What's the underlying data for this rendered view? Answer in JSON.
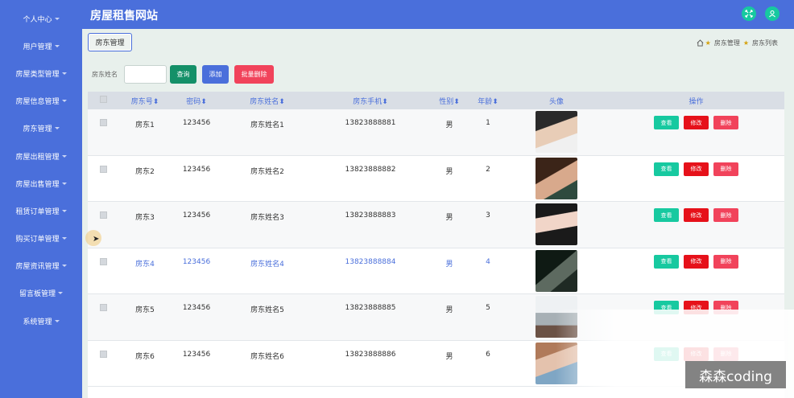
{
  "site_title": "房屋租售网站",
  "sidebar": {
    "items": [
      {
        "label": "个人中心"
      },
      {
        "label": "用户管理"
      },
      {
        "label": "房屋类型管理"
      },
      {
        "label": "房屋信息管理"
      },
      {
        "label": "房东管理"
      },
      {
        "label": "房屋出租管理"
      },
      {
        "label": "房屋出售管理"
      },
      {
        "label": "租赁订单管理"
      },
      {
        "label": "购买订单管理"
      },
      {
        "label": "房屋资讯管理"
      },
      {
        "label": "留言板管理"
      },
      {
        "label": "系统管理"
      }
    ]
  },
  "tab": {
    "label": "房东管理"
  },
  "breadcrumb": {
    "home_icon": "home-icon",
    "item1": "房东管理",
    "item2": "房东列表"
  },
  "search": {
    "label": "房东姓名",
    "value": "",
    "query_label": "查询",
    "add_label": "添加",
    "batch_delete_label": "批量删除"
  },
  "table": {
    "headers": {
      "id": "房东号",
      "password": "密码",
      "name": "房东姓名",
      "phone": "房东手机",
      "gender": "性别",
      "age": "年龄",
      "avatar": "头像",
      "ops": "操作"
    },
    "op_labels": {
      "view": "查看",
      "edit": "修改",
      "delete": "删除"
    },
    "rows": [
      {
        "id": "房东1",
        "password": "123456",
        "name": "房东姓名1",
        "phone": "13823888881",
        "gender": "男",
        "age": "1"
      },
      {
        "id": "房东2",
        "password": "123456",
        "name": "房东姓名2",
        "phone": "13823888882",
        "gender": "男",
        "age": "2"
      },
      {
        "id": "房东3",
        "password": "123456",
        "name": "房东姓名3",
        "phone": "13823888883",
        "gender": "男",
        "age": "3"
      },
      {
        "id": "房东4",
        "password": "123456",
        "name": "房东姓名4",
        "phone": "13823888884",
        "gender": "男",
        "age": "4"
      },
      {
        "id": "房东5",
        "password": "123456",
        "name": "房东姓名5",
        "phone": "13823888885",
        "gender": "男",
        "age": "5"
      },
      {
        "id": "房东6",
        "password": "123456",
        "name": "房东姓名6",
        "phone": "13823888886",
        "gender": "男",
        "age": "6"
      }
    ]
  },
  "watermark": "森森coding",
  "colors": {
    "primary": "#4a6fdb",
    "success": "#17c9a0",
    "danger": "#e6111a",
    "pink": "#f1435b",
    "query": "#149068"
  }
}
